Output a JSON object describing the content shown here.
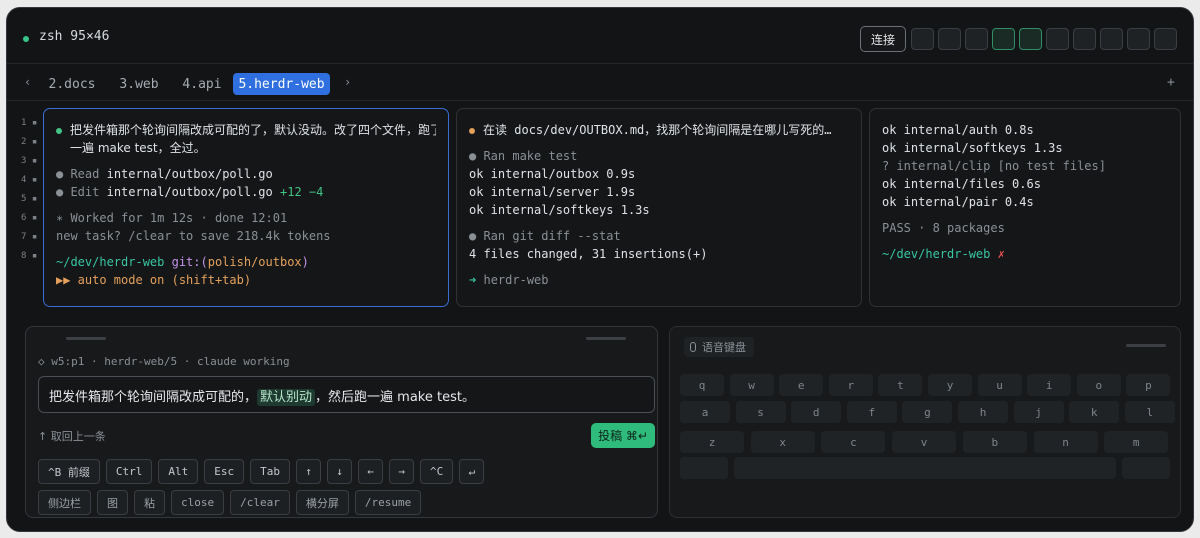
{
  "header": {
    "title": "zsh 95×46",
    "connect_label": "连接",
    "slot_count": 10,
    "active_slots": [
      3,
      4
    ]
  },
  "tabs": {
    "prev": "‹",
    "next": "›",
    "add": "+",
    "items": [
      "2.docs",
      "3.web",
      "4.api",
      "5.herdr-web"
    ],
    "active_index": 3
  },
  "gutter": [
    "1",
    "2",
    "3",
    "4",
    "5",
    "6",
    "7",
    "8"
  ],
  "pane1": {
    "msg_line1": "把发件箱那个轮询间隔改成可配的了，默认没动。改了四个文件，跑了",
    "msg_line2": "一遍 make test，全过。",
    "read_label": "Read",
    "read_path": "internal/outbox/poll.go",
    "edit_label": "Edit",
    "edit_path": "internal/outbox/poll.go",
    "edit_add": "+12",
    "edit_del": "−4",
    "worked": "∗ Worked for 1m 12s · done 12:01",
    "new_task": "new task? /clear to save 218.4k tokens",
    "cwd": "~/dev/herdr-web",
    "git_prefix": "git:(",
    "git_branch": "polish/outbox",
    "git_suffix": ")",
    "auto_mode": "▶▶ auto mode on (shift+tab)"
  },
  "pane2": {
    "reading_prefix": "在读",
    "reading": " docs/dev/OUTBOX.md，找那个轮询间隔是在哪儿写死的…",
    "ran_make": "Ran make test",
    "results": [
      "ok internal/outbox 0.9s",
      "ok internal/server 1.9s",
      "ok internal/softkeys 1.3s"
    ],
    "ran_diff": "Ran git diff --stat",
    "diff_summary": "4 files changed, 31 insertions(+)",
    "link": "herdr-web"
  },
  "pane3": {
    "results": [
      "ok internal/auth 0.8s",
      "ok internal/softkeys 1.3s",
      "? internal/clip [no test files]",
      "ok internal/files 0.6s",
      "ok internal/pair 0.4s"
    ],
    "pass": "PASS · 8 packages",
    "prompt": "~/dev/herdr-web",
    "fail_mark": "✗"
  },
  "composer": {
    "context": "◇ w5:p1 · herdr-web/5 · claude working",
    "text_before": "把发件箱那个轮询间隔改成可配的，",
    "text_highlight": "默认别动",
    "text_after": "，然后跑一遍 make test。",
    "recall": "↑ 取回上一条",
    "submit": "投稿 ⌘↵",
    "keys_row1": [
      "^B 前缀",
      "Ctrl",
      "Alt",
      "Esc",
      "Tab",
      "↑",
      "↓",
      "←",
      "→",
      "^C",
      "↵"
    ],
    "keys_row2": [
      "侧边栏",
      "图",
      "粘",
      "close",
      "/clear",
      "横分屏",
      "/resume"
    ]
  },
  "keyboard": {
    "voice_label": "语音键盘",
    "row1": [
      "q",
      "w",
      "e",
      "r",
      "t",
      "y",
      "u",
      "i",
      "o",
      "p"
    ],
    "row2": [
      "a",
      "s",
      "d",
      "f",
      "g",
      "h",
      "j",
      "k",
      "l"
    ],
    "row3": [
      "z",
      "x",
      "c",
      "v",
      "b",
      "n",
      "m"
    ]
  },
  "colors": {
    "accent_blue": "#2f6fe0",
    "green": "#43c486",
    "submit_green": "#2fbb7c",
    "orange": "#e5a05c"
  }
}
